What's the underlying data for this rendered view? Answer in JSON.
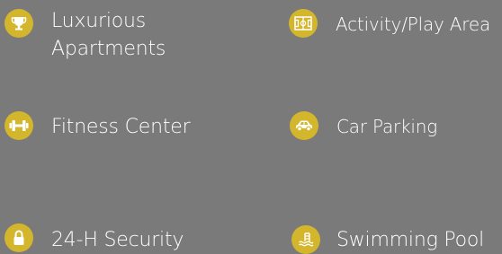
{
  "amenities": [
    {
      "label_line1": "Luxurious",
      "label_line2": "Apartments",
      "icon": "trophy-icon"
    },
    {
      "label": "Activity/Play Area",
      "icon": "play-area-icon"
    },
    {
      "label": "Fitness Center",
      "icon": "dumbbell-icon"
    },
    {
      "label": "Car Parking",
      "icon": "car-icon"
    },
    {
      "label": "24-H Security",
      "icon": "lock-icon"
    },
    {
      "label": "Swimming Pool",
      "icon": "swimming-pool-icon"
    }
  ],
  "colors": {
    "background": "#7a7a7a",
    "accent": "#d3b62b",
    "text": "#ffffff"
  }
}
